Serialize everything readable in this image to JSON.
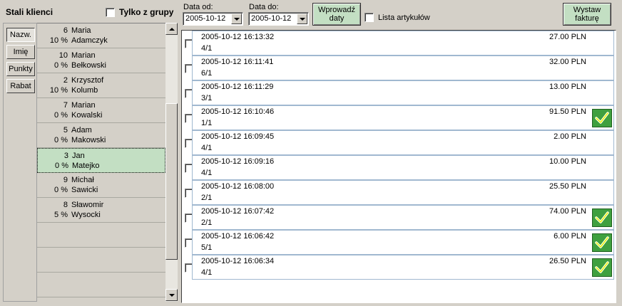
{
  "left": {
    "title": "Stali klienci",
    "group_checkbox_label": "Tylko z grupy",
    "sort_buttons": [
      "Nazw.",
      "Imię",
      "Punkty",
      "Rabat"
    ],
    "clients": [
      {
        "num": "6",
        "pct": "10 %",
        "first": "Maria",
        "last": "Adamczyk"
      },
      {
        "num": "10",
        "pct": "0 %",
        "first": "Marian",
        "last": "Bełkowski"
      },
      {
        "num": "2",
        "pct": "10 %",
        "first": "Krzysztof",
        "last": "Kolumb"
      },
      {
        "num": "7",
        "pct": "0 %",
        "first": "Marian",
        "last": "Kowalski"
      },
      {
        "num": "5",
        "pct": "0 %",
        "first": "Adam",
        "last": "Makowski"
      },
      {
        "num": "3",
        "pct": "0 %",
        "first": "Jan",
        "last": "Matejko"
      },
      {
        "num": "9",
        "pct": "0 %",
        "first": "Michał",
        "last": "Sawicki"
      },
      {
        "num": "8",
        "pct": "5 %",
        "first": "Sławomir",
        "last": "Wysocki"
      }
    ]
  },
  "filters": {
    "date_from_label": "Data od:",
    "date_from_value": "2005-10-12",
    "date_to_label": "Data do:",
    "date_to_value": "2005-10-12",
    "enter_dates_line1": "Wprowadź",
    "enter_dates_line2": "daty",
    "articles_label": "Lista artykułów",
    "invoice_line1": "Wystaw",
    "invoice_line2": "fakturę"
  },
  "sales": [
    {
      "datetime": "2005-10-12 16:13:32",
      "ref": "4/1",
      "amount": "27.00 PLN",
      "invoiced": false
    },
    {
      "datetime": "2005-10-12 16:11:41",
      "ref": "6/1",
      "amount": "32.00 PLN",
      "invoiced": false
    },
    {
      "datetime": "2005-10-12 16:11:29",
      "ref": "3/1",
      "amount": "13.00 PLN",
      "invoiced": false
    },
    {
      "datetime": "2005-10-12 16:10:46",
      "ref": "1/1",
      "amount": "91.50 PLN",
      "invoiced": true
    },
    {
      "datetime": "2005-10-12 16:09:45",
      "ref": "4/1",
      "amount": "2.00 PLN",
      "invoiced": false
    },
    {
      "datetime": "2005-10-12 16:09:16",
      "ref": "4/1",
      "amount": "10.00 PLN",
      "invoiced": false
    },
    {
      "datetime": "2005-10-12 16:08:00",
      "ref": "2/1",
      "amount": "25.50 PLN",
      "invoiced": false
    },
    {
      "datetime": "2005-10-12 16:07:42",
      "ref": "2/1",
      "amount": "74.00 PLN",
      "invoiced": true
    },
    {
      "datetime": "2005-10-12 16:06:42",
      "ref": "5/1",
      "amount": "6.00 PLN",
      "invoiced": true
    },
    {
      "datetime": "2005-10-12 16:06:34",
      "ref": "4/1",
      "amount": "26.50 PLN",
      "invoiced": true
    }
  ],
  "colors": {
    "accent_green": "#c3dfc3",
    "check_green": "#3fa03f",
    "window_gray": "#d4d0c8"
  }
}
